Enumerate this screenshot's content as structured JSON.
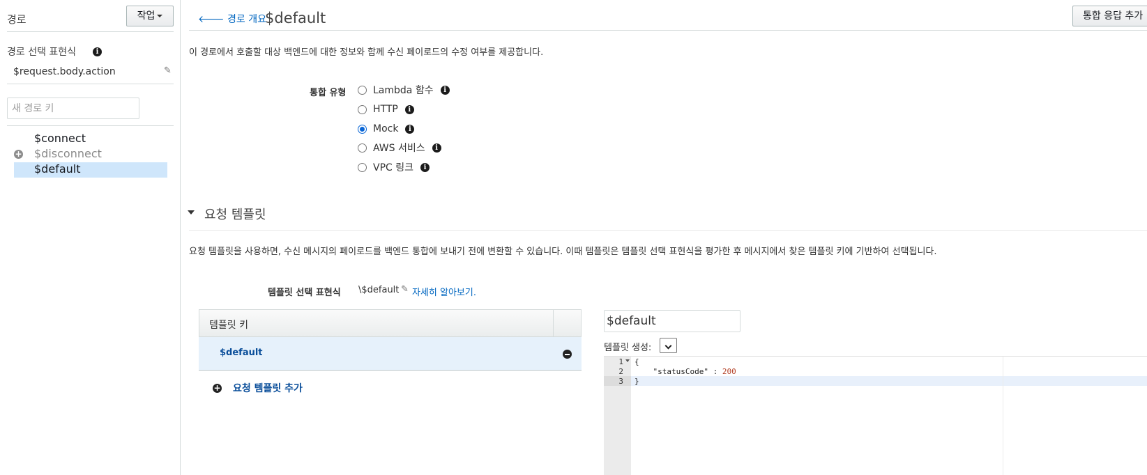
{
  "sidebar": {
    "title": "경로",
    "action_button": "작업",
    "selection_expression_label": "경로 선택 표현식",
    "selection_expression_value": "$request.body.action",
    "new_route_placeholder": "새 경로 키",
    "routes": [
      {
        "label": "$connect",
        "state": "normal"
      },
      {
        "label": "$disconnect",
        "state": "muted"
      },
      {
        "label": "$default",
        "state": "selected"
      }
    ]
  },
  "header": {
    "back_link": "경로 개요",
    "title": "$default",
    "top_button": "통합 응답 추가"
  },
  "description": "이 경로에서 호출할 대상 백엔드에 대한 정보와 함께 수신 페이로드의 수정 여부를 제공합니다.",
  "integration": {
    "label": "통합 유형",
    "options": [
      {
        "label": "Lambda 함수",
        "checked": false
      },
      {
        "label": "HTTP",
        "checked": false
      },
      {
        "label": "Mock",
        "checked": true
      },
      {
        "label": "AWS 서비스",
        "checked": false
      },
      {
        "label": "VPC 링크",
        "checked": false
      }
    ]
  },
  "request_templates": {
    "section_title": "요청 템플릿",
    "description": "요청 템플릿을 사용하면, 수신 메시지의 페이로드를 백엔드 통합에 보내기 전에 변환할 수 있습니다. 이때 템플릿은 템플릿 선택 표현식을 평가한 후 메시지에서 찾은 템플릿 키에 기반하여 선택됩니다.",
    "selection_expression_label": "템플릿 선택 표현식",
    "selection_expression_value": "\\$default",
    "learn_more": "자세히 알아보기.",
    "table_header": "템플릿 키",
    "keys": [
      "$default"
    ],
    "add_button": "요청 템플릿 추가",
    "key_input_value": "$default",
    "generate_label": "템플릿 생성:"
  },
  "editor": {
    "line_numbers": [
      "1",
      "2",
      "3"
    ],
    "lines": [
      "{",
      "    \"statusCode\" : ",
      "}"
    ],
    "status_code_value": "200"
  },
  "icons": {
    "back": "arrow-left-icon",
    "info": "info-icon",
    "edit": "pencil-icon",
    "add": "plus-circle-icon",
    "remove": "minus-circle-icon"
  },
  "colors": {
    "link": "#0066c0",
    "selected_route_bg": "#cfe6fb",
    "selected_row_bg": "#e6f1fb",
    "radio_checked": "#0a66d6"
  }
}
